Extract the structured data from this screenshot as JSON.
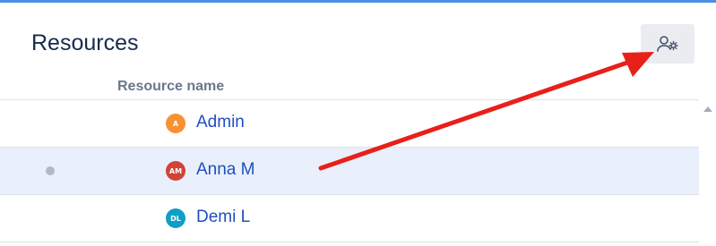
{
  "panel": {
    "title": "Resources",
    "column_header": "Resource name"
  },
  "settings_button": {
    "icon": "user-settings-icon"
  },
  "resources": [
    {
      "initials": "A",
      "name": "Admin",
      "avatar_color": "#f79232",
      "selected": false
    },
    {
      "initials": "AM",
      "name": "Anna M",
      "avatar_color": "#d04437",
      "selected": true
    },
    {
      "initials": "DL",
      "name": "Demi L",
      "avatar_color": "#0e9fc4",
      "selected": false
    }
  ],
  "colors": {
    "accent": "#4a90e2",
    "link": "#1e4fbf",
    "selected_row": "#e9f0fb",
    "annotation_arrow": "#e8201a"
  },
  "annotation": {
    "type": "arrow",
    "target": "settings_button"
  }
}
